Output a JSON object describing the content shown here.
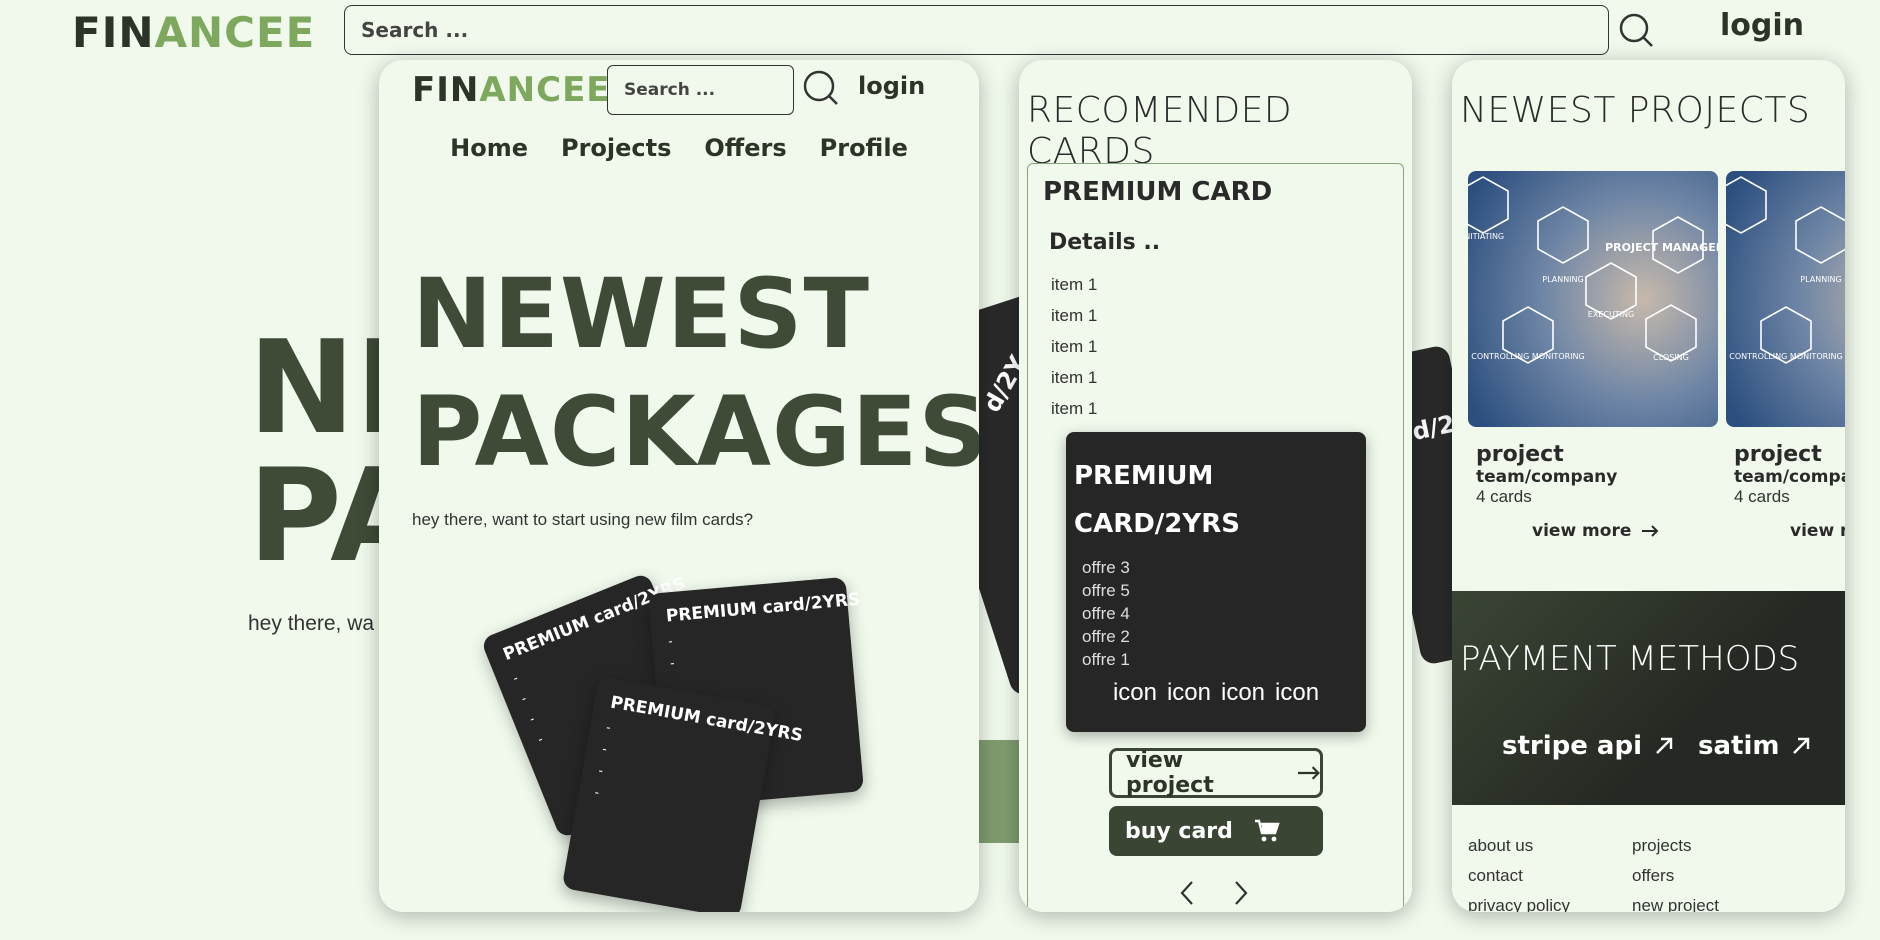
{
  "background": {
    "logo": {
      "dark": "FIN",
      "green": "ANCEE"
    },
    "search": {
      "placeholder": "Search ..."
    },
    "login": "login",
    "headline_line1": "NE",
    "headline_line2": "PA",
    "subtitle": "hey there, wa",
    "card_text_1": "d/2Y",
    "card_text_2": "d/2Y"
  },
  "panel_home": {
    "logo": {
      "dark": "FIN",
      "green": "ANCEE"
    },
    "search": {
      "placeholder": "Search ..."
    },
    "login": "login",
    "nav": [
      "Home",
      "Projects",
      "Offers",
      "Profile"
    ],
    "headline_line1": "NEWEST",
    "headline_line2": "PACKAGES",
    "subtitle": "hey there, want to start using new film cards?",
    "cards": [
      {
        "title": "PREMIUM card/2YRS"
      },
      {
        "title": "PREMIUM card/2YRS"
      },
      {
        "title": "PREMIUM card/2YRS"
      }
    ],
    "card_dash": "-"
  },
  "panel_cards": {
    "title": "RECOMENDED CARDS",
    "card_title": "PREMIUM CARD",
    "details_label": "Details ..",
    "items": [
      "item 1",
      "item 1",
      "item 1",
      "item 1",
      "item 1"
    ],
    "dark_card": {
      "title_line1": "PREMIUM",
      "title_line2": "CARD/2YRS",
      "offres": [
        "offre 3",
        "offre 5",
        "offre 4",
        "offre 2",
        "offre 1"
      ],
      "icons": [
        "icon",
        "icon",
        "icon",
        "icon"
      ]
    },
    "view_button": "view project",
    "buy_button": "buy card"
  },
  "panel_projects": {
    "title": "NEWEST PROJECTS",
    "projects": [
      {
        "name": "project",
        "team": "team/company",
        "count": "4 cards",
        "more": "view more"
      },
      {
        "name": "project",
        "team": "team/company",
        "count": "4 cards",
        "more": "view more"
      }
    ],
    "image_labels": [
      "PROJECT MANAGEMENT",
      "PLANNING",
      "EXECUTING",
      "CONTROLLING MONITORING",
      "CLOSING",
      "INITIATING"
    ],
    "payment": {
      "title": "PAYMENT METHODS",
      "methods": [
        "stripe api",
        "satim"
      ]
    },
    "footer": {
      "links": [
        "about  us",
        "projects",
        "contact",
        "offers",
        "privacy policy",
        "new project"
      ]
    }
  },
  "colors": {
    "page_bg": "#f0f9ec",
    "accent_green": "#7da85e",
    "dark_olive": "#3b4534",
    "card_dark": "#262626"
  }
}
